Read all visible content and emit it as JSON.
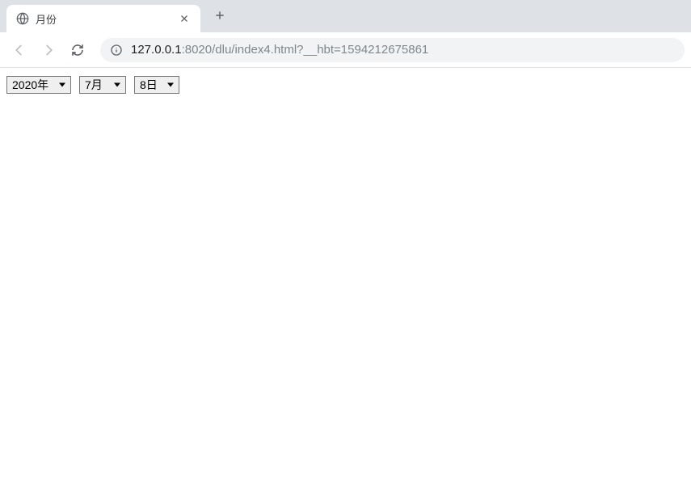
{
  "browser": {
    "tab": {
      "title": "月份"
    },
    "url": {
      "host": "127.0.0.1",
      "port": ":8020",
      "path": "/dlu/index4.html?__hbt=1594212675861"
    }
  },
  "page": {
    "year": {
      "selected": "2020年"
    },
    "month": {
      "selected": "7月"
    },
    "day": {
      "selected": "8日"
    }
  }
}
